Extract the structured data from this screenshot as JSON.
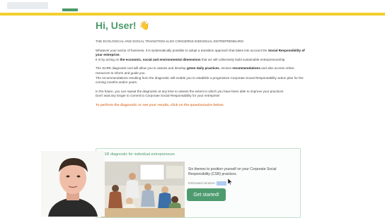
{
  "greeting": {
    "text": "Hi, User!",
    "wave_icon": "waving-hand-icon"
  },
  "paragraphs": {
    "intro": "THE ECOLOGICAL AND SOCIAL TRANSITION ALSO CONCERNS INDIVIDUAL ENTREPRENEURS!",
    "p2_line1_a": "Whatever your sector of business, it is systematically possible to adopt a transition approach that takes into account the ",
    "p2_line1_b": "Social Responsibility of your entreprise.",
    "p2_line2_a": "It is by acting on ",
    "p2_line2_b": "the economic, social and environmental dimensions",
    "p2_line2_c": " that we will collectively build sustainable entrepreneurship.",
    "p3_a": "The SURE diagnostic tool will allow you to assess and develop ",
    "p3_b": "green daily practices",
    "p3_c": ", receive ",
    "p3_d": "recommendations",
    "p3_e": " and also access online resources to inform and guide you.",
    "p3_f": "The recommendations resulting from the diagnostic will enable you to establish a progressive Corporate Social Responsability action plan for the coming months and/or years.",
    "p4_a": "In the future, you can repeat the diagnostic at any time to assess the extent to which you have been able to improve your practices.",
    "p4_b": "Don't wait any longer to commit to Corporate Social Responsability for your entreprise!",
    "cta": "To perform the diagnostic or see your results, click on the questionnaire below:"
  },
  "card": {
    "title": "CSR diagnostic for individual entrepreneurs",
    "description": "Six themes to position yourself on your Corporate Social Responsibility (CSR) practices.",
    "duration_label": "Estimated duration:",
    "button": "Get started!"
  },
  "colors": {
    "accent_green": "#4c9a6a",
    "cta_orange": "#e07b3c",
    "top_border_yellow": "#f2cf2e"
  }
}
